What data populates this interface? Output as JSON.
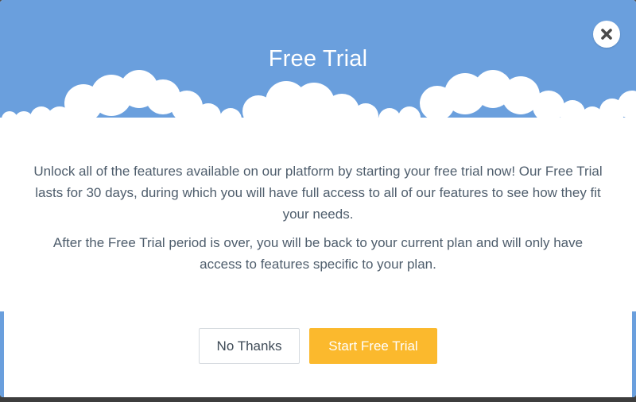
{
  "dialog": {
    "title": "Free Trial",
    "close_icon": "close-icon",
    "paragraphs": [
      "Unlock all of the features available on our platform by starting your free trial now! Our Free Trial lasts for 30 days, during which you will have full access to all of our features to see how they fit your needs.",
      "After the Free Trial period is over, you will be back to your current plan and will only have access to features specific to your plan."
    ],
    "secondary_button": "No Thanks",
    "primary_button": "Start Free Trial"
  },
  "colors": {
    "header_blue": "#6a9fdd",
    "primary_orange": "#fbb92d",
    "body_text": "#4e5d6c"
  }
}
